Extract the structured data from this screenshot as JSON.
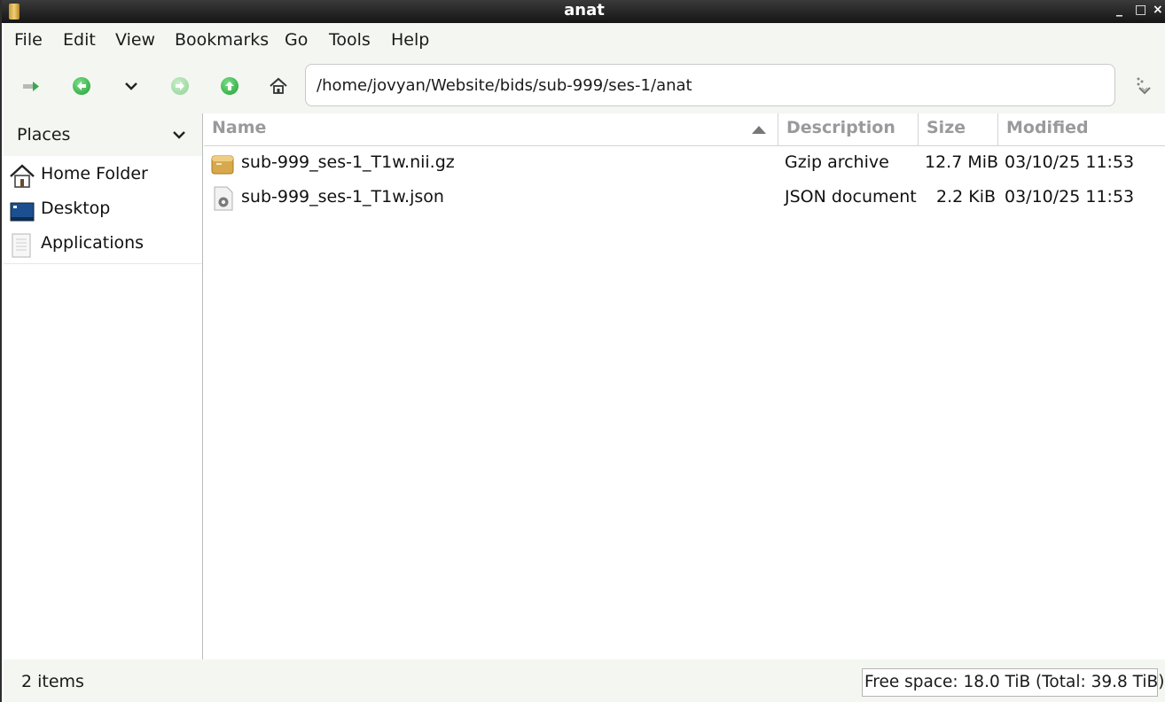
{
  "window": {
    "title": "anat",
    "controls": [
      "_",
      "□",
      "×"
    ]
  },
  "menu": [
    "File",
    "Edit",
    "View",
    "Bookmarks",
    "Go",
    "Tools",
    "Help"
  ],
  "toolbar": {
    "location": "/home/jovyan/Website/bids/sub-999/ses-1/anat"
  },
  "sidebar": {
    "header": "Places",
    "items": [
      {
        "label": "Home Folder",
        "icon": "home-folder-icon"
      },
      {
        "label": "Desktop",
        "icon": "desktop-icon"
      },
      {
        "label": "Applications",
        "icon": "applications-icon"
      }
    ]
  },
  "files": {
    "columns": [
      "Name",
      "Description",
      "Size",
      "Modified"
    ],
    "sort_column": "Name",
    "rows": [
      {
        "name": "sub-999_ses-1_T1w.nii.gz",
        "description": "Gzip archive",
        "size": "12.7 MiB",
        "modified": "03/10/25 11:53",
        "icon": "archive-icon"
      },
      {
        "name": "sub-999_ses-1_T1w.json",
        "description": "JSON document",
        "size": "2.2 KiB",
        "modified": "03/10/25 11:53",
        "icon": "script-file-icon"
      }
    ]
  },
  "status": {
    "count": "2 items",
    "free_space": "Free space: 18.0 TiB (Total: 39.8 TiB)"
  },
  "colors": {
    "accent_green": "#1f9e31",
    "chrome": "#f4f7f1",
    "header_text": "#9a9a9a"
  }
}
